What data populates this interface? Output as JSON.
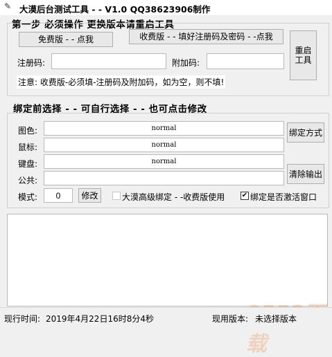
{
  "window": {
    "title": "大漠后台测试工具 - - V1.0   QQ38623906制作",
    "icon": "app-icon"
  },
  "step": {
    "heading": "第一步  必须操作   更换版本请重启工具",
    "free_button": "免费版 - - 点我",
    "paid_button": "收费版 - - 填好注册码及密码 - -点我",
    "restart_button": "重启工具",
    "reg_code_label": "注册码:",
    "reg_code_value": "",
    "extra_code_label": "附加码:",
    "extra_code_value": "",
    "note": "注意: 收费版-必须填-注册码及附加码，如为空，则不填!"
  },
  "bind": {
    "heading": "绑定前选择 - - 可自行选择 - - 也可点击修改",
    "display_label": "图色:",
    "display_value": "normal",
    "mouse_label": "鼠标:",
    "mouse_value": "normal",
    "keyboard_label": "键盘:",
    "keyboard_value": "normal",
    "public_label": "公共:",
    "public_value": "",
    "bind_mode_button": "绑定方式",
    "clear_output_button": "清除输出",
    "mode_label": "模式:",
    "mode_value": "0",
    "modify_button": "修改",
    "advanced_bind_label": "大漠高级绑定 - -收费版使用",
    "activate_window_label": "绑定是否激活窗口"
  },
  "status": {
    "time_label": "现行时间: ",
    "time_value": "2019年4月22日16时8分4秒",
    "version_label": "现用版本: ",
    "version_value": "未选择版本"
  },
  "watermark": "9553下载"
}
